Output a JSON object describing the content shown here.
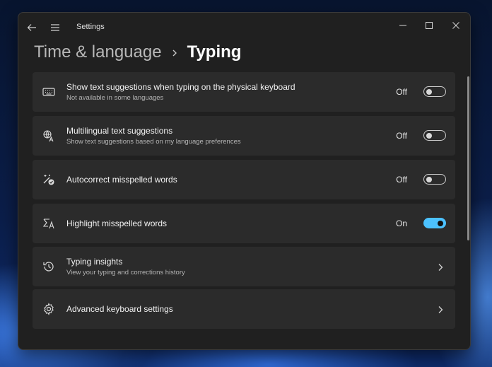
{
  "window": {
    "title": "Settings"
  },
  "breadcrumb": {
    "parent": "Time & language",
    "current": "Typing"
  },
  "settings": [
    {
      "icon": "keyboard-icon",
      "title": "Show text suggestions when typing on the physical keyboard",
      "subtitle": "Not available in some languages",
      "state": "Off",
      "on": false
    },
    {
      "icon": "multilingual-icon",
      "title": "Multilingual text suggestions",
      "subtitle": "Show text suggestions based on my language preferences",
      "state": "Off",
      "on": false
    },
    {
      "icon": "autocorrect-icon",
      "title": "Autocorrect misspelled words",
      "subtitle": "",
      "state": "Off",
      "on": false
    },
    {
      "icon": "spellcheck-icon",
      "title": "Highlight misspelled words",
      "subtitle": "",
      "state": "On",
      "on": true
    },
    {
      "icon": "history-icon",
      "title": "Typing insights",
      "subtitle": "View your typing and corrections history"
    },
    {
      "icon": "gear-icon",
      "title": "Advanced keyboard settings",
      "subtitle": ""
    }
  ],
  "colors": {
    "accent": "#4cc2ff",
    "window_bg": "#202020",
    "card_bg": "#2b2b2b"
  }
}
